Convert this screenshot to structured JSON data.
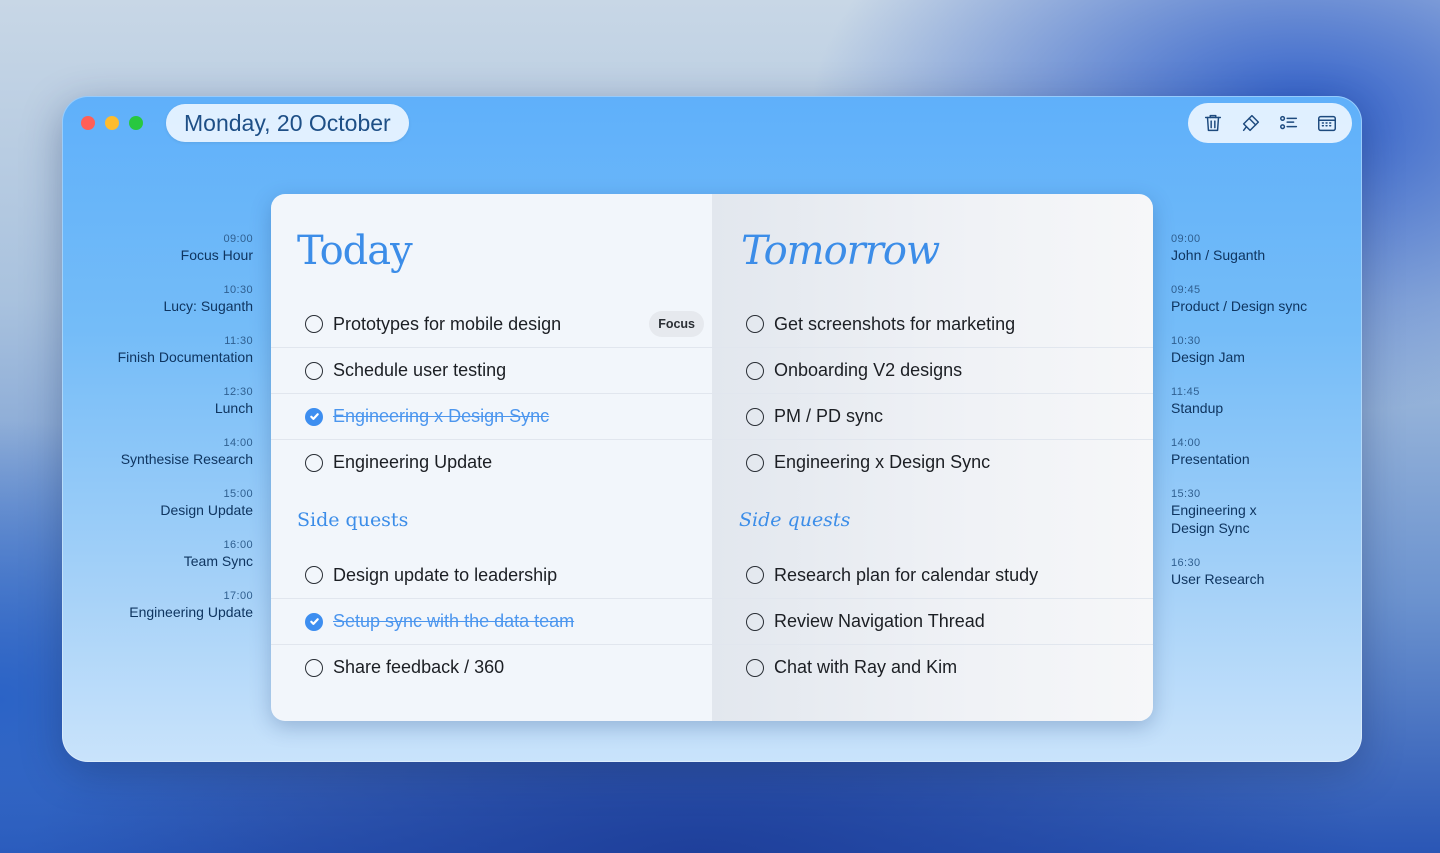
{
  "header": {
    "date": "Monday, 20 October"
  },
  "toolbar": {
    "icons": [
      "trash-icon",
      "hammer-icon",
      "checklist-icon",
      "calendar-icon"
    ]
  },
  "schedule_left": [
    {
      "time": "09:00",
      "name": "Focus Hour"
    },
    {
      "time": "10:30",
      "name": "Lucy: Suganth"
    },
    {
      "time": "11:30",
      "name": "Finish Documentation"
    },
    {
      "time": "12:30",
      "name": "Lunch"
    },
    {
      "time": "14:00",
      "name": "Synthesise Research"
    },
    {
      "time": "15:00",
      "name": "Design Update"
    },
    {
      "time": "16:00",
      "name": "Team Sync"
    },
    {
      "time": "17:00",
      "name": "Engineering Update"
    }
  ],
  "schedule_right": [
    {
      "time": "09:00",
      "name": "John / Suganth"
    },
    {
      "time": "09:45",
      "name": "Product / Design sync"
    },
    {
      "time": "10:30",
      "name": "Design Jam"
    },
    {
      "time": "11:45",
      "name": "Standup"
    },
    {
      "time": "14:00",
      "name": "Presentation"
    },
    {
      "time": "15:30",
      "name": "Engineering x",
      "name2": "Design Sync"
    },
    {
      "time": "16:30",
      "name": "User Research"
    }
  ],
  "today": {
    "title": "Today",
    "tasks": [
      {
        "label": "Prototypes for mobile design",
        "done": false,
        "badge": "Focus"
      },
      {
        "label": "Schedule user testing",
        "done": false
      },
      {
        "label": "Engineering x Design Sync",
        "done": true
      },
      {
        "label": "Engineering Update",
        "done": false
      }
    ],
    "side_title": "Side quests",
    "side_tasks": [
      {
        "label": "Design update to leadership",
        "done": false
      },
      {
        "label": "Setup sync with the data team",
        "done": true
      },
      {
        "label": "Share feedback / 360",
        "done": false
      }
    ]
  },
  "tomorrow": {
    "title": "Tomorrow",
    "tasks": [
      {
        "label": "Get screenshots for marketing",
        "done": false
      },
      {
        "label": "Onboarding V2 designs",
        "done": false
      },
      {
        "label": "PM / PD sync",
        "done": false
      },
      {
        "label": "Engineering x Design Sync",
        "done": false
      }
    ],
    "side_title": "Side quests",
    "side_tasks": [
      {
        "label": "Research plan for calendar study",
        "done": false
      },
      {
        "label": "Review Navigation Thread",
        "done": false
      },
      {
        "label": "Chat with Ray and Kim",
        "done": false
      }
    ]
  }
}
